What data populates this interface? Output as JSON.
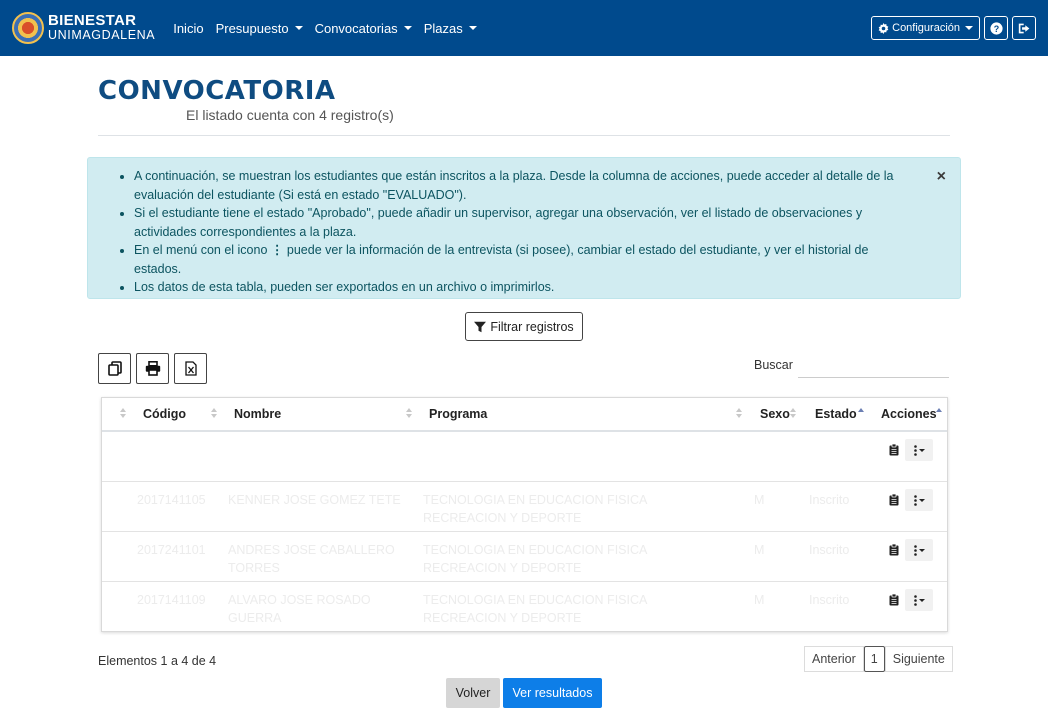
{
  "navbar": {
    "brand_line1": "BIENESTAR",
    "brand_line2": "UNIMAGDALENA",
    "links": [
      {
        "label": "Inicio",
        "dropdown": false
      },
      {
        "label": "Presupuesto",
        "dropdown": true
      },
      {
        "label": "Convocatorias",
        "dropdown": true
      },
      {
        "label": "Plazas",
        "dropdown": true
      }
    ],
    "config_label": "Configuración",
    "icons": {
      "config": "gear-icon",
      "help": "question-circle-icon",
      "logout": "sign-out-icon"
    }
  },
  "header": {
    "title": "CONVOCATORIA",
    "subtitle": "El listado cuenta con 4 registro(s)"
  },
  "alert": {
    "items": [
      "A continuación, se muestran los estudiantes que están inscritos a la plaza. Desde la columna de acciones, puede acceder al detalle de la evaluación del estudiante (Si está en estado \"EVALUADO\").",
      "Si el estudiante tiene el estado \"Aprobado\", puede añadir un supervisor, agregar una observación, ver el listado de observaciones y actividades correspondientes a la plaza.",
      "puede ver la información de la entrevista (si posee), cambiar el estado del estudiante, y ver el historial de estados.",
      "Los datos de esta tabla, pueden ser exportados en un archivo o imprimirlos."
    ],
    "item3_prefix": "En el menú con el icono",
    "close_symbol": "×"
  },
  "filter_button": {
    "label": "Filtrar registros",
    "icon": "filter-icon"
  },
  "toolbar": {
    "export_icons": [
      "copy-icon",
      "print-icon",
      "excel-icon"
    ],
    "search_label": "Buscar",
    "search_value": ""
  },
  "table": {
    "columns": [
      "",
      "Código",
      "Nombre",
      "Programa",
      "Sexo",
      "Estado",
      "Acciones"
    ],
    "rows": [
      {
        "codigo": "",
        "nombre": "",
        "programa": "",
        "sexo": "",
        "estado": ""
      },
      {
        "codigo": "2017141105",
        "nombre": "KENNER JOSE GOMEZ TETE",
        "programa": "TECNOLOGIA EN EDUCACION FISICA RECREACION Y DEPORTE",
        "sexo": "M",
        "estado": "Inscrito"
      },
      {
        "codigo": "2017241101",
        "nombre": "ANDRES JOSE CABALLERO TORRES",
        "programa": "TECNOLOGIA EN EDUCACION FISICA RECREACION Y DEPORTE",
        "sexo": "M",
        "estado": "Inscrito"
      },
      {
        "codigo": "2017141109",
        "nombre": "ALVARO JOSE ROSADO GUERRA",
        "programa": "TECNOLOGIA EN EDUCACION FISICA RECREACION Y DEPORTE",
        "sexo": "M",
        "estado": "Inscrito"
      }
    ],
    "action_icons": [
      "clipboard-icon",
      "kebab-menu-icon"
    ]
  },
  "footer": {
    "info": "Elementos 1 a 4 de 4",
    "pagination": {
      "prev": "Anterior",
      "current": "1",
      "next": "Siguiente"
    },
    "volver_label": "Volver",
    "ver_resultados_label": "Ver resultados"
  },
  "colors": {
    "navbar": "#004a8d",
    "title": "#0f4c81",
    "alert_bg": "#d1ecf1",
    "primary_button": "#0d7ee8"
  }
}
